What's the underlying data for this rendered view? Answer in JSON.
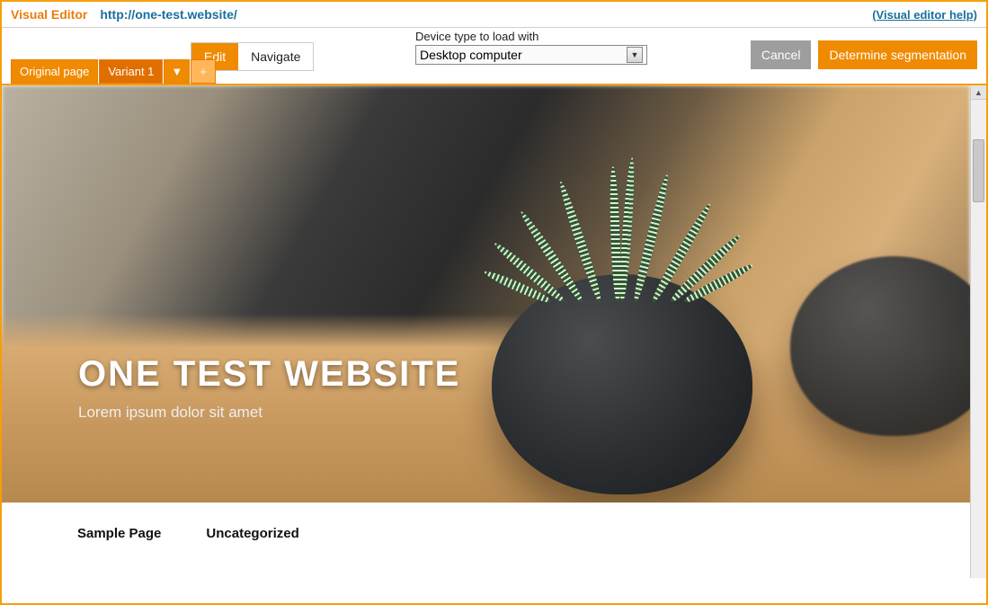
{
  "header": {
    "title": "Visual Editor",
    "url": "http://one-test.website/",
    "help_link": "(Visual editor help)"
  },
  "device": {
    "label": "Device type to load with",
    "selected": "Desktop computer"
  },
  "mode": {
    "edit": "Edit",
    "navigate": "Navigate"
  },
  "variants": {
    "original": "Original page",
    "variant1": "Variant 1",
    "dropdown_glyph": "▼",
    "add_glyph": "+"
  },
  "actions": {
    "cancel": "Cancel",
    "determine": "Determine segmentation"
  },
  "hero": {
    "title": "ONE TEST WEBSITE",
    "subtitle": "Lorem ipsum dolor sit amet"
  },
  "nav": {
    "item1": "Sample Page",
    "item2": "Uncategorized"
  }
}
